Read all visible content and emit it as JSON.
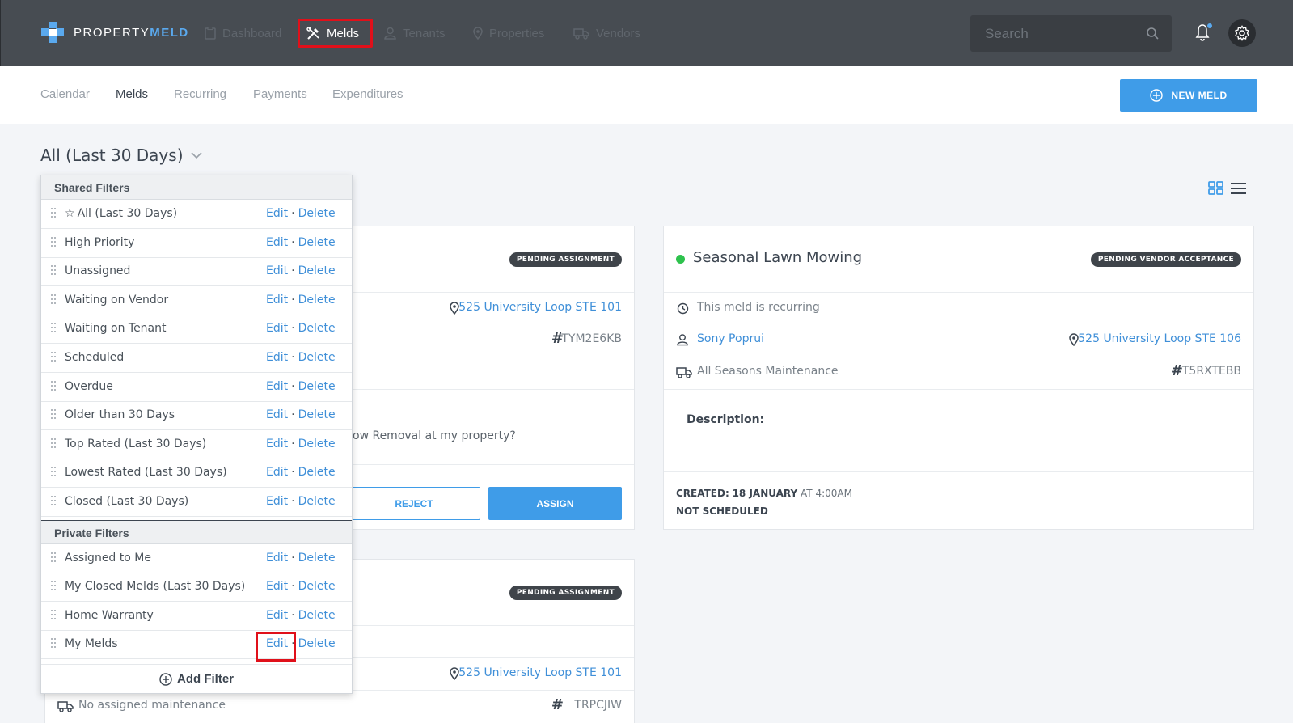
{
  "app": {
    "logo_part1": "PROPERTY",
    "logo_part2": "MELD",
    "colors": {
      "accent": "#3f9ce8",
      "topbar": "#474c52",
      "highlight": "#e0101a",
      "status_green": "#2ec24d"
    }
  },
  "topnav": {
    "items": [
      {
        "label": "Dashboard",
        "icon": "clipboard-icon"
      },
      {
        "label": "Melds",
        "icon": "tools-icon"
      },
      {
        "label": "Tenants",
        "icon": "user-icon"
      },
      {
        "label": "Properties",
        "icon": "map-pin-icon"
      },
      {
        "label": "Vendors",
        "icon": "truck-icon"
      }
    ],
    "search_placeholder": "Search"
  },
  "subnav": {
    "tabs": [
      "Calendar",
      "Melds",
      "Recurring",
      "Payments",
      "Expenditures"
    ],
    "new_meld": "NEW MELD"
  },
  "filter": {
    "title": "All (Last 30 Days)"
  },
  "dropdown": {
    "shared_header": "Shared Filters",
    "private_header": "Private Filters",
    "edit": "Edit",
    "delete": "Delete",
    "dot": "·",
    "shared": [
      "All (Last 30 Days)",
      "High Priority",
      "Unassigned",
      "Waiting on Vendor",
      "Waiting on Tenant",
      "Scheduled",
      "Overdue",
      "Older than 30 Days",
      "Top Rated (Last 30 Days)",
      "Lowest Rated (Last 30 Days)",
      "Closed (Last 30 Days)"
    ],
    "private": [
      "Assigned to Me",
      "My Closed Melds (Last 30 Days)",
      "Home Warranty",
      "My Melds"
    ],
    "add_filter": "Add Filter"
  },
  "card1": {
    "badge": "PENDING ASSIGNMENT",
    "address": "525 University Loop STE 101",
    "ref": "TYM2E6KB",
    "description_fragment": "ow Removal at my property?",
    "reject": "REJECT",
    "assign": "ASSIGN"
  },
  "card2": {
    "title": "Seasonal Lawn Mowing",
    "badge": "PENDING VENDOR ACCEPTANCE",
    "recurring": "This meld is recurring",
    "tenant": "Sony Poprui",
    "address": "525 University Loop STE 106",
    "vendor": "All Seasons Maintenance",
    "ref": "T5RXTEBB",
    "description_label": "Description:",
    "created_label": "CREATED:",
    "created_date": "18 JANUARY",
    "created_at": "AT",
    "created_time": "4:00AM",
    "scheduled": "NOT SCHEDULED"
  },
  "card3": {
    "badge": "PENDING ASSIGNMENT",
    "address": "525 University Loop STE 101",
    "maintenance": "No assigned maintenance",
    "ref": "TRPCJIW"
  }
}
